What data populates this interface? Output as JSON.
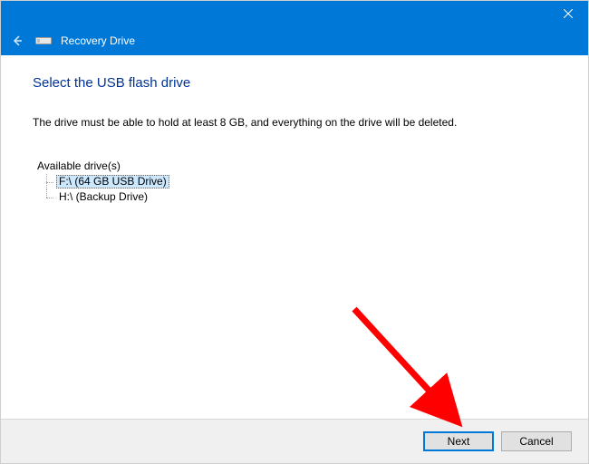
{
  "titlebar": {
    "close_tooltip": "Close"
  },
  "header": {
    "title": "Recovery Drive"
  },
  "main": {
    "heading": "Select the USB flash drive",
    "description": "The drive must be able to hold at least 8 GB, and everything on the drive will be deleted.",
    "available_label": "Available drive(s)",
    "drives": [
      {
        "label": "F:\\ (64 GB USB Drive)",
        "selected": true
      },
      {
        "label": "H:\\ (Backup Drive)",
        "selected": false
      }
    ]
  },
  "footer": {
    "next": "Next",
    "cancel": "Cancel"
  },
  "colors": {
    "accent": "#0078d7",
    "heading": "#003399",
    "annotation_arrow": "#ff0000"
  }
}
